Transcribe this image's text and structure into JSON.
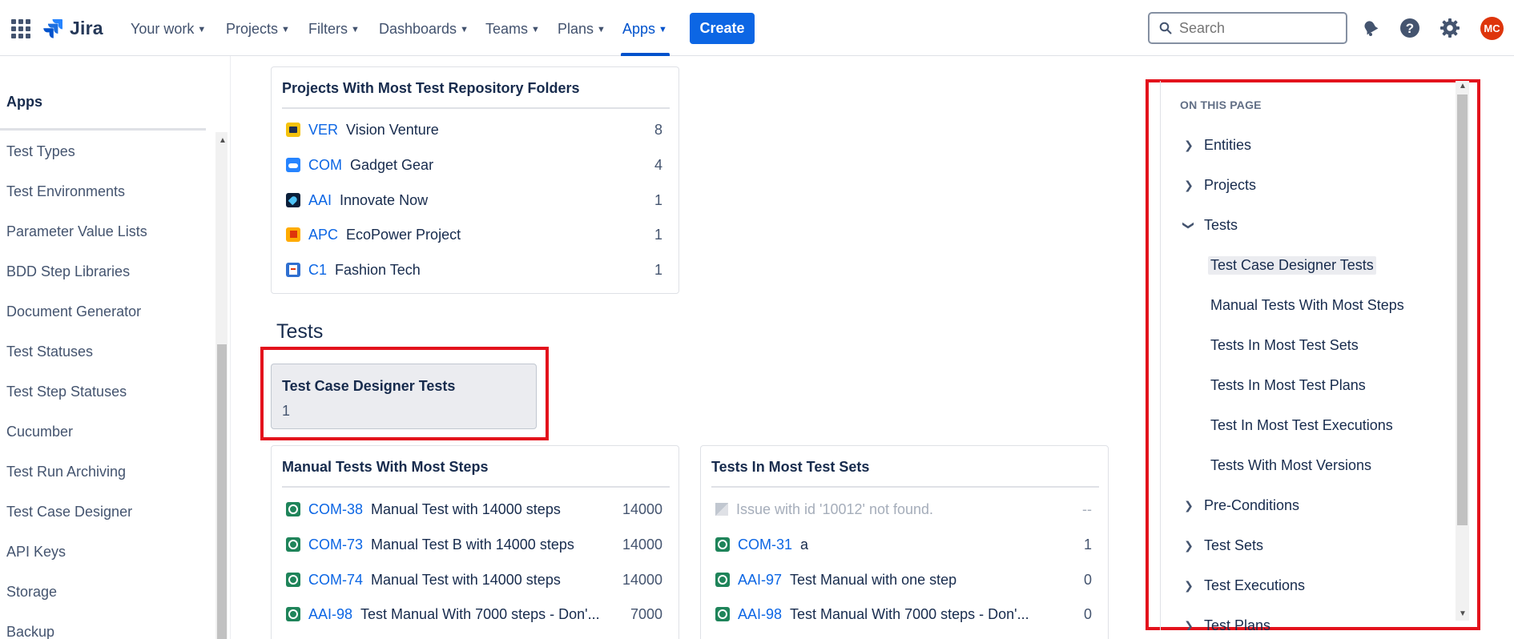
{
  "nav": {
    "logo_text": "Jira",
    "items": [
      {
        "label": "Your work"
      },
      {
        "label": "Projects"
      },
      {
        "label": "Filters"
      },
      {
        "label": "Dashboards"
      },
      {
        "label": "Teams"
      },
      {
        "label": "Plans"
      },
      {
        "label": "Apps"
      }
    ],
    "active_item": "Apps",
    "create_label": "Create",
    "search_placeholder": "Search",
    "avatar_initials": "MC",
    "accent_color": "#0c66e4",
    "avatar_color": "#de350b"
  },
  "sidebar": {
    "title": "Apps",
    "items": [
      "Test Types",
      "Test Environments",
      "Parameter Value Lists",
      "BDD Step Libraries",
      "Document Generator",
      "Test Statuses",
      "Test Step Statuses",
      "Cucumber",
      "Test Run Archiving",
      "Test Case Designer",
      "API Keys",
      "Storage",
      "Backup"
    ]
  },
  "folders_card": {
    "title": "Projects With Most Test Repository Folders",
    "rows": [
      {
        "key": "VER",
        "name": "Vision Venture",
        "value": "8",
        "icon": "project-icon-yellow"
      },
      {
        "key": "COM",
        "name": "Gadget Gear",
        "value": "4",
        "icon": "project-icon-cloud"
      },
      {
        "key": "AAI",
        "name": "Innovate Now",
        "value": "1",
        "icon": "project-icon-rocket"
      },
      {
        "key": "APC",
        "name": "EcoPower Project",
        "value": "1",
        "icon": "project-icon-flag"
      },
      {
        "key": "C1",
        "name": "Fashion Tech",
        "value": "1",
        "icon": "project-icon-doc"
      }
    ]
  },
  "tests_section": {
    "heading": "Tests",
    "tcd_card": {
      "title": "Test Case Designer Tests",
      "value": "1"
    }
  },
  "manual_steps_card": {
    "title": "Manual Tests With Most Steps",
    "rows": [
      {
        "key": "COM-38",
        "name": "Manual Test with 14000 steps",
        "value": "14000"
      },
      {
        "key": "COM-73",
        "name": "Manual Test B with 14000 steps",
        "value": "14000"
      },
      {
        "key": "COM-74",
        "name": "Manual Test with 14000 steps",
        "value": "14000"
      },
      {
        "key": "AAI-98",
        "name": "Test Manual With 7000 steps - Don'...",
        "value": "7000"
      }
    ]
  },
  "test_sets_card": {
    "title": "Tests In Most Test Sets",
    "missing_row": {
      "name": "Issue with id '10012' not found.",
      "value": "--"
    },
    "rows": [
      {
        "key": "COM-31",
        "name": "a",
        "value": "1"
      },
      {
        "key": "AAI-97",
        "name": "Test Manual with one step",
        "value": "0"
      },
      {
        "key": "AAI-98",
        "name": "Test Manual With 7000 steps - Don'...",
        "value": "0"
      }
    ]
  },
  "on_this_page": {
    "title": "ON THIS PAGE",
    "top_items": [
      "Entities",
      "Projects"
    ],
    "expanded_item": "Tests",
    "sub_items": [
      "Test Case Designer Tests",
      "Manual Tests With Most Steps",
      "Tests In Most Test Sets",
      "Tests In Most Test Plans",
      "Test In Most Test Executions",
      "Tests With Most Versions"
    ],
    "active_sub_item": "Test Case Designer Tests",
    "after_items": [
      "Pre-Conditions",
      "Test Sets",
      "Test Executions",
      "Test Plans"
    ]
  },
  "highlight_color": "#e3121c"
}
